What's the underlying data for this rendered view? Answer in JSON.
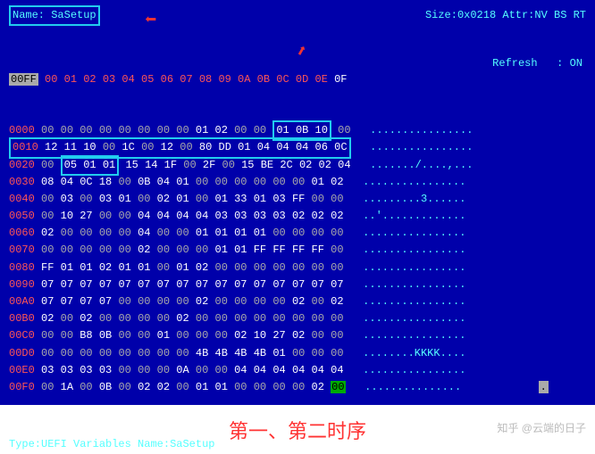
{
  "header": {
    "name_label": "Name: ",
    "name_value": "SaSetup",
    "size_label": "Size:",
    "size_value": "0x0218",
    "attr_label": "Attr:",
    "attr_value": "NV BS RT"
  },
  "col_header_offset": "00FF",
  "col_header_hex": "00 01 02 03 04 05 06 07 08 09 0A 0B 0C 0D 0E",
  "col_header_last": "0F",
  "side_panel": {
    "refresh_label": "Refresh   :",
    "refresh_value": "ON"
  },
  "rows": [
    {
      "off": "0000",
      "hex": [
        "00",
        "00",
        "00",
        "00",
        "00",
        "00",
        "00",
        "00",
        "01",
        "02",
        "00",
        "00"
      ],
      "box_start": 12,
      "box_vals": [
        "01",
        "0B",
        "10"
      ],
      "tail": [
        "00"
      ],
      "ascii": "................"
    },
    {
      "off": "0010",
      "full_box": true,
      "hex": [
        "12",
        "11",
        "10",
        "00",
        "1C",
        "00",
        "12",
        "00",
        "80",
        "DD",
        "01",
        "04",
        "04",
        "04",
        "06",
        "0C"
      ],
      "ascii": "................"
    },
    {
      "off": "0020",
      "pre": [
        "00"
      ],
      "box_vals": [
        "05",
        "01",
        "01"
      ],
      "post": [
        "15",
        "14",
        "1F",
        "00",
        "2F",
        "00",
        "15",
        "BE",
        "2C",
        "02",
        "02",
        "04"
      ],
      "ascii": "......./....,..."
    },
    {
      "off": "0030",
      "hex": [
        "08",
        "04",
        "0C",
        "18",
        "00",
        "0B",
        "04",
        "01",
        "00",
        "00",
        "00",
        "00",
        "00",
        "00",
        "01",
        "02"
      ],
      "ascii": "................"
    },
    {
      "off": "0040",
      "hex": [
        "00",
        "03",
        "00",
        "03",
        "01",
        "00",
        "02",
        "01",
        "00",
        "01",
        "33",
        "01",
        "03",
        "FF",
        "00",
        "00"
      ],
      "ascii": ".........3......"
    },
    {
      "off": "0050",
      "hex": [
        "00",
        "10",
        "27",
        "00",
        "00",
        "04",
        "04",
        "04",
        "04",
        "03",
        "03",
        "03",
        "03",
        "02",
        "02",
        "02"
      ],
      "ascii": "..'............."
    },
    {
      "off": "0060",
      "hex": [
        "02",
        "00",
        "00",
        "00",
        "00",
        "04",
        "00",
        "00",
        "01",
        "01",
        "01",
        "01",
        "00",
        "00",
        "00",
        "00"
      ],
      "ascii": "................"
    },
    {
      "off": "0070",
      "hex": [
        "00",
        "00",
        "00",
        "00",
        "00",
        "02",
        "00",
        "00",
        "00",
        "01",
        "01",
        "FF",
        "FF",
        "FF",
        "FF",
        "00"
      ],
      "ascii": "................"
    },
    {
      "off": "0080",
      "hex": [
        "FF",
        "01",
        "01",
        "02",
        "01",
        "01",
        "00",
        "01",
        "02",
        "00",
        "00",
        "00",
        "00",
        "00",
        "00",
        "00"
      ],
      "ascii": "................"
    },
    {
      "off": "0090",
      "hex": [
        "07",
        "07",
        "07",
        "07",
        "07",
        "07",
        "07",
        "07",
        "07",
        "07",
        "07",
        "07",
        "07",
        "07",
        "07",
        "07"
      ],
      "ascii": "................"
    },
    {
      "off": "00A0",
      "hex": [
        "07",
        "07",
        "07",
        "07",
        "00",
        "00",
        "00",
        "00",
        "02",
        "00",
        "00",
        "00",
        "00",
        "02",
        "00",
        "02"
      ],
      "ascii": "................"
    },
    {
      "off": "00B0",
      "hex": [
        "02",
        "00",
        "02",
        "00",
        "00",
        "00",
        "00",
        "02",
        "00",
        "00",
        "00",
        "00",
        "00",
        "00",
        "00",
        "00"
      ],
      "ascii": "................"
    },
    {
      "off": "00C0",
      "hex": [
        "00",
        "00",
        "B8",
        "0B",
        "00",
        "00",
        "01",
        "00",
        "00",
        "00",
        "02",
        "10",
        "27",
        "02",
        "00",
        "00"
      ],
      "ascii": "................"
    },
    {
      "off": "00D0",
      "hex": [
        "00",
        "00",
        "00",
        "00",
        "00",
        "00",
        "00",
        "00",
        "4B",
        "4B",
        "4B",
        "4B",
        "01",
        "00",
        "00",
        "00"
      ],
      "ascii": "........KKKK...."
    },
    {
      "off": "00E0",
      "hex": [
        "03",
        "03",
        "03",
        "03",
        "00",
        "00",
        "00",
        "0A",
        "00",
        "00",
        "04",
        "04",
        "04",
        "04",
        "04",
        "04"
      ],
      "ascii": "................"
    },
    {
      "off": "00F0",
      "hex": [
        "00",
        "1A",
        "00",
        "0B",
        "00",
        "02",
        "02",
        "00",
        "01",
        "01",
        "00",
        "00",
        "00",
        "00",
        "02"
      ],
      "last_hl": "00",
      "ascii": "..............."
    }
  ],
  "footer": {
    "type_label": "Type:",
    "type_value": "UEFI Variables",
    "name_label": "Name:",
    "name_value": "SaSetup"
  },
  "caption": "第一、第二时序",
  "watermark": "知乎 @云端的日子"
}
